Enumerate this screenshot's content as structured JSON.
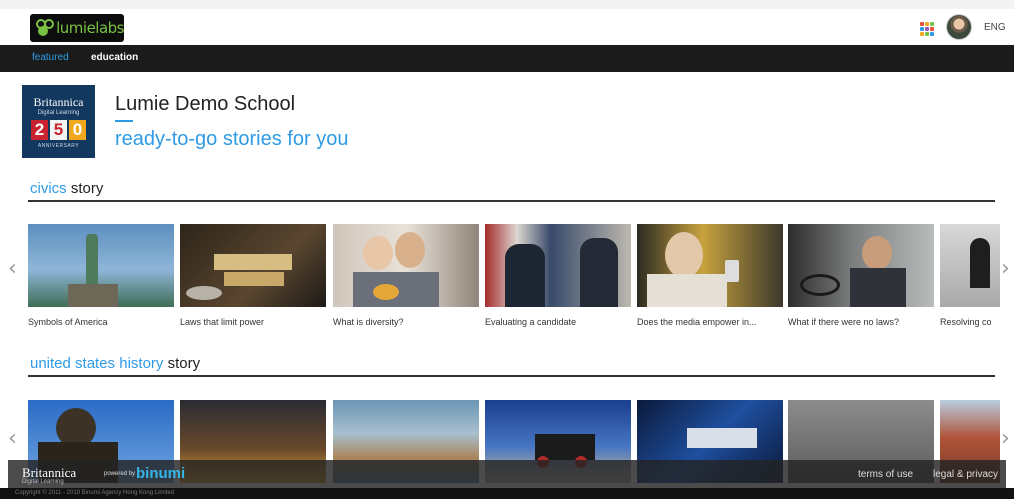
{
  "header": {
    "logo_text": "lumielabs",
    "language": "ENG"
  },
  "nav": {
    "featured": "featured",
    "education": "education"
  },
  "school": {
    "badge_brand": "Britannica",
    "badge_sub": "Digital Learning",
    "badge_digits": [
      "2",
      "5",
      "0"
    ],
    "badge_anniversary": "ANNIVERSARY",
    "name": "Lumie Demo School",
    "tagline": "ready-to-go stories for you"
  },
  "sections": [
    {
      "highlight": "civics",
      "suffix": " story",
      "cards": [
        {
          "label": "Symbols of America",
          "image": "statue-of-liberty"
        },
        {
          "label": "Laws that limit power",
          "image": "civil-law-blocks"
        },
        {
          "label": "What is diversity?",
          "image": "couple-portrait"
        },
        {
          "label": "Evaluating a candidate",
          "image": "politicians-handshake"
        },
        {
          "label": "Does the media empower in...",
          "image": "woman-phone"
        },
        {
          "label": "What if there were no laws?",
          "image": "man-driving"
        },
        {
          "label": "Resolving co",
          "image": "man-sitting"
        }
      ]
    },
    {
      "highlight": "united states history",
      "suffix": " story",
      "cards": [
        {
          "label": "",
          "image": "washington-statue"
        },
        {
          "label": "",
          "image": "city-highway-night"
        },
        {
          "label": "",
          "image": "hoover-dam"
        },
        {
          "label": "",
          "image": "steam-locomotive"
        },
        {
          "label": "",
          "image": "wall-street-chart"
        },
        {
          "label": "",
          "image": "field-grayscale"
        },
        {
          "label": "",
          "image": "canyon-mesa"
        }
      ]
    }
  ],
  "footer": {
    "brand": "Britannica",
    "brand_sub": "Digital Learning",
    "powered_by": "powered by",
    "binumi": "binumi",
    "terms": "terms of use",
    "legal": "legal & privacy",
    "copyright": "Copyright © 2011 - 2019 Binumi Agency Hong Kong Limited"
  },
  "colors": {
    "accent": "#2f9be6",
    "nav_bg": "#1b1b1b",
    "logo_green": "#7ac143"
  }
}
